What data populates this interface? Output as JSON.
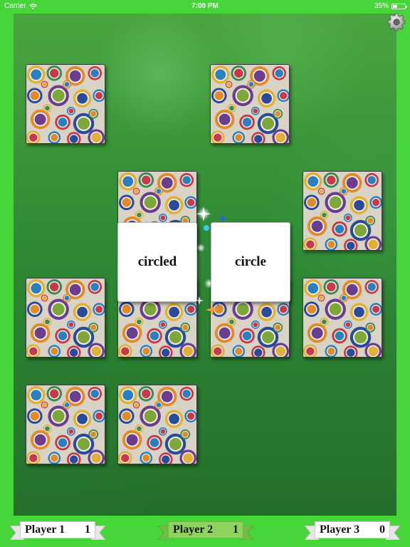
{
  "status": {
    "carrier": "Carrier",
    "time": "7:00 PM",
    "battery": "35%",
    "battery_level": 0.35
  },
  "settings_icon": "gear-icon",
  "board": {
    "card_back_pattern": "colorful-circles",
    "face_up_cards": [
      {
        "word": "circled"
      },
      {
        "word": "circle"
      }
    ]
  },
  "players": [
    {
      "name": "Player 1",
      "score": "1",
      "active": false
    },
    {
      "name": "Player 2",
      "score": "1",
      "active": true
    },
    {
      "name": "Player 3",
      "score": "0",
      "active": false
    }
  ],
  "colors": {
    "background": "#46d63a",
    "board_green": "#2f8a35",
    "active_banner": "#8fd35f"
  }
}
